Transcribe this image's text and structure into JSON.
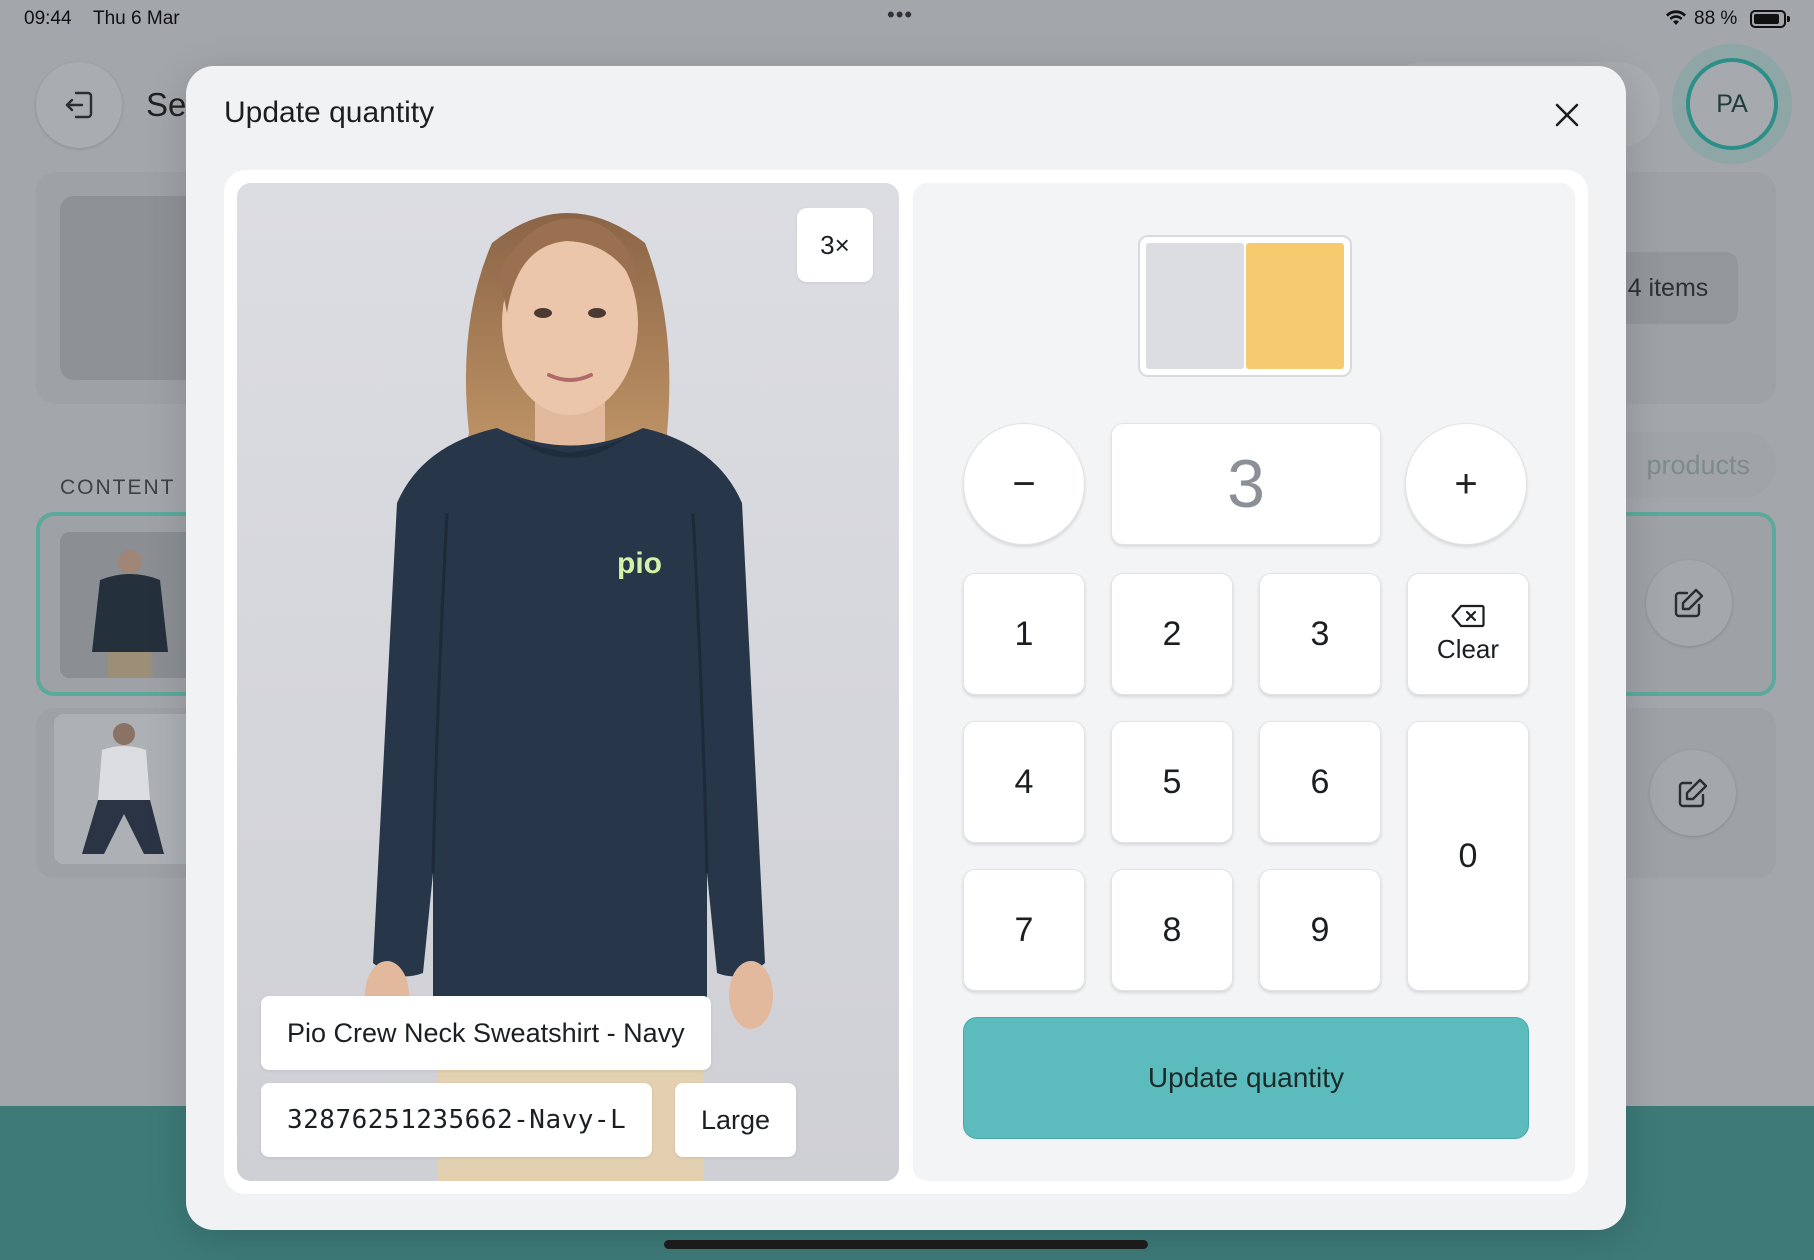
{
  "status_bar": {
    "time": "09:44",
    "date": "Thu 6 Mar",
    "battery_percent": "88 %",
    "battery_level": 0.88
  },
  "background": {
    "title": "Se",
    "avatar_initials": "PA",
    "items_badge": "4 items",
    "section_label": "CONTENT",
    "products_button": "products"
  },
  "modal": {
    "title": "Update quantity",
    "product": {
      "name": "Pio Crew Neck Sweatshirt - Navy",
      "sku": "32876251235662-Navy-L",
      "size": "Large",
      "quantity_badge": "3×",
      "logo_text": "pio",
      "image_icon": "product-photo-sweatshirt"
    },
    "location": {
      "shelves": [
        {
          "color": "#dcdde0",
          "active": false
        },
        {
          "color": "#f6cb6f",
          "active": true
        }
      ]
    },
    "quantity": "3",
    "keys": [
      "1",
      "2",
      "3",
      "4",
      "5",
      "6",
      "7",
      "8",
      "9",
      "0"
    ],
    "clear_label": "Clear",
    "minus_symbol": "−",
    "plus_symbol": "+",
    "submit_label": "Update quantity",
    "accent_color": "#5cbcbd"
  }
}
